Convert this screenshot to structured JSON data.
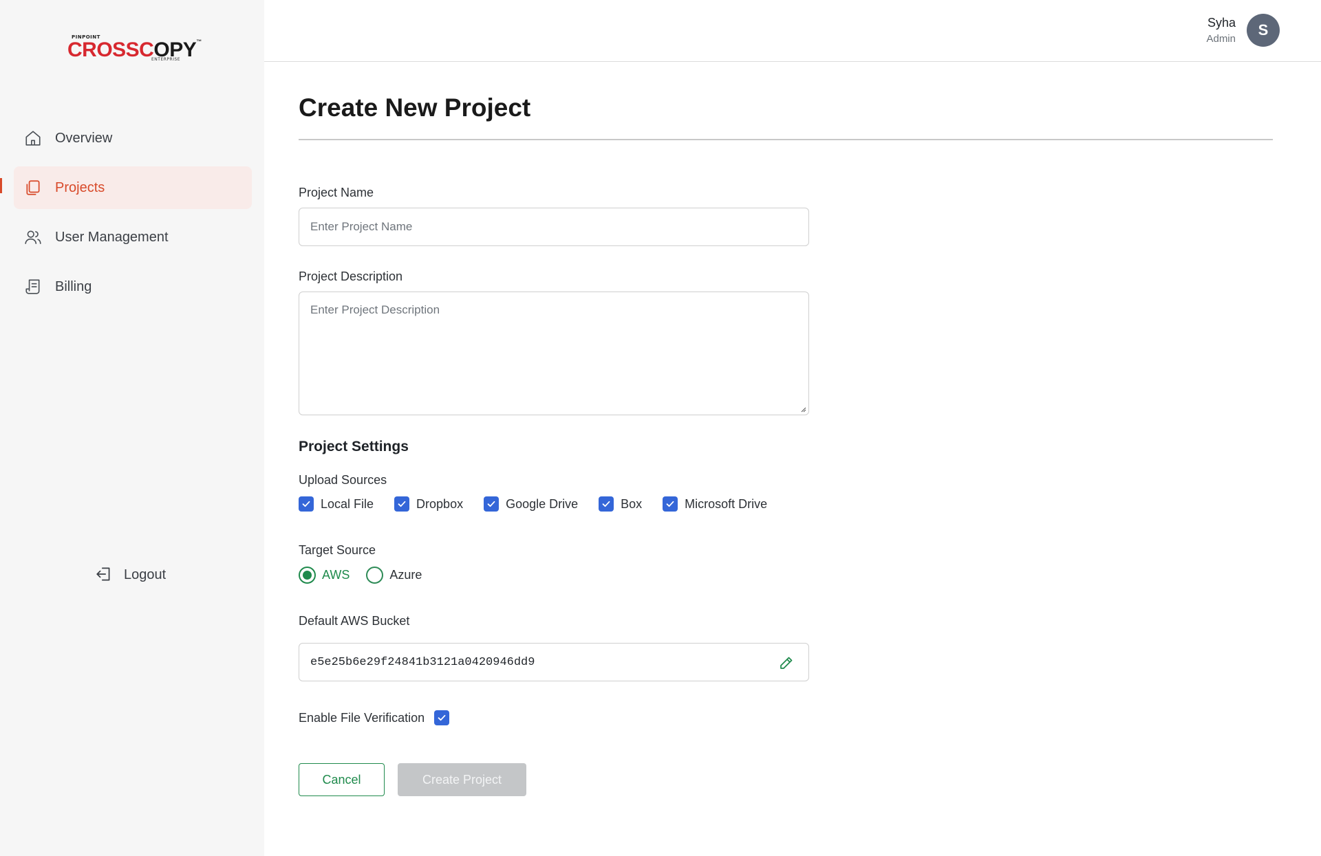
{
  "logo": {
    "small_text": "PINPOINT",
    "brand_red": "CROSSC",
    "brand_o": "O",
    "brand_dark": "PY",
    "sub_text": "ENTERPRISE",
    "tm": "™"
  },
  "sidebar": {
    "items": [
      {
        "label": "Overview",
        "icon": "home-icon"
      },
      {
        "label": "Projects",
        "icon": "projects-icon",
        "active": true
      },
      {
        "label": "User Management",
        "icon": "users-icon"
      },
      {
        "label": "Billing",
        "icon": "billing-icon"
      }
    ],
    "logout_label": "Logout"
  },
  "header": {
    "user_name": "Syha",
    "user_role": "Admin",
    "avatar_initial": "S"
  },
  "page": {
    "title": "Create New Project"
  },
  "form": {
    "project_name": {
      "label": "Project Name",
      "placeholder": "Enter Project Name"
    },
    "project_description": {
      "label": "Project Description",
      "placeholder": "Enter Project Description"
    },
    "settings_title": "Project Settings",
    "upload_sources": {
      "label": "Upload Sources",
      "options": [
        {
          "label": "Local File",
          "checked": true
        },
        {
          "label": "Dropbox",
          "checked": true
        },
        {
          "label": "Google Drive",
          "checked": true
        },
        {
          "label": "Box",
          "checked": true
        },
        {
          "label": "Microsoft Drive",
          "checked": true
        }
      ]
    },
    "target_source": {
      "label": "Target Source",
      "options": [
        {
          "label": "AWS",
          "selected": true
        },
        {
          "label": "Azure",
          "selected": false
        }
      ]
    },
    "bucket": {
      "label": "Default AWS Bucket",
      "value": "e5e25b6e29f24841b3121a0420946dd9"
    },
    "file_verification": {
      "label": "Enable File Verification",
      "checked": true
    },
    "cancel_label": "Cancel",
    "create_label": "Create Project"
  },
  "colors": {
    "accent_active": "#d84a2a",
    "checkbox": "#3466d8",
    "green": "#1f8a4c",
    "disabled_button": "#c4c6c8"
  }
}
